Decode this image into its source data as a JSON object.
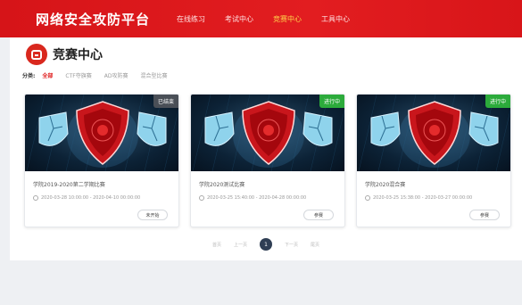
{
  "header": {
    "brand": "网络安全攻防平台",
    "nav": [
      {
        "label": "在线练习",
        "active": false
      },
      {
        "label": "考试中心",
        "active": false
      },
      {
        "label": "竞赛中心",
        "active": true
      },
      {
        "label": "工具中心",
        "active": false
      }
    ]
  },
  "page": {
    "title": "竞赛中心"
  },
  "filters": {
    "label": "分类:",
    "items": [
      {
        "label": "全部",
        "active": true
      },
      {
        "label": "CTF夺旗赛",
        "active": false
      },
      {
        "label": "AD攻防赛",
        "active": false
      },
      {
        "label": "混合型比赛",
        "active": false
      }
    ]
  },
  "cards": [
    {
      "name": "学院2019-2020第二学期比赛",
      "status": "已结束",
      "status_type": "ended",
      "time": "2020-03-28 10:00:00 - 2020-04-10 00:00:00",
      "button": "未开始"
    },
    {
      "name": "学院2020测试比赛",
      "status": "进行中",
      "status_type": "running",
      "time": "2020-03-25 15:40:00 - 2020-04-28 00:00:00",
      "button": "参赛"
    },
    {
      "name": "学院2020混合赛",
      "status": "进行中",
      "status_type": "running",
      "time": "2020-03-25 15:38:00 - 2020-03-27 00:00:00",
      "button": "参赛"
    }
  ],
  "pager": {
    "first": "首页",
    "prev": "上一页",
    "current": "1",
    "next": "下一页",
    "last": "尾页"
  },
  "colors": {
    "brand_red": "#e21d20",
    "active_nav": "#ffd24a",
    "running_badge": "#2cab3b",
    "ended_badge": "#4a4f57",
    "pager_current": "#2f3e54"
  }
}
